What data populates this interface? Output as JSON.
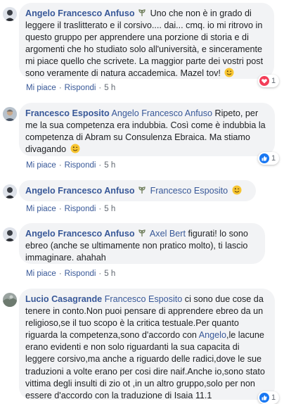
{
  "colors": {
    "link": "#385898",
    "bubble": "#f2f3f5",
    "meta": "#606770",
    "love": "#f33e58",
    "like": "#1877f2"
  },
  "comments": [
    {
      "author": "Angelo Francesco Anfuso",
      "badge_icon": "group-expert-badge-icon",
      "text": "Uno che non è in grado di leggere il traslitterato e il corsivo.... dai... cmq. io mi ritrovo in questo gruppo per apprendere una porzione di storia e di argomenti che ho studiato solo all'università, e sinceramente mi piace quello che scrivete. La maggior parte dei vostri post sono veramente di natura accademica. Mazel tov!",
      "emoji": "winking-face-emoji",
      "like": "Mi piace",
      "reply": "Rispondi",
      "time": "5 h",
      "reaction": {
        "icon": "love-reaction-icon",
        "count": "1"
      }
    },
    {
      "author": "Francesco Esposito",
      "mention": "Angelo Francesco Anfuso",
      "text": "Ripeto, per me la sua competenza era indubbia. Così come è indubbia la competenza di Abram su Consulenza Ebraica. Ma stiamo divagando",
      "emoji": "winking-face-emoji",
      "like": "Mi piace",
      "reply": "Rispondi",
      "time": "5 h",
      "reaction": {
        "icon": "like-reaction-icon",
        "count": "1"
      }
    },
    {
      "author": "Angelo Francesco Anfuso",
      "badge_icon": "group-expert-badge-icon",
      "mention": "Francesco Esposito",
      "emoji": "winking-face-emoji",
      "like": "Mi piace",
      "reply": "Rispondi",
      "time": "5 h"
    },
    {
      "author": "Angelo Francesco Anfuso",
      "badge_icon": "group-expert-badge-icon",
      "mention": "Axel Bert",
      "text": "figurati! lo sono ebreo (anche se ultimamente non pratico molto), ti lascio immaginare. ahahah",
      "like": "Mi piace",
      "reply": "Rispondi",
      "time": "5 h"
    },
    {
      "author": "Lucio Casagrande",
      "mention": "Francesco Esposito",
      "text_before": "ci sono due cose da tenere in conto.Non puoi pensare di apprendere ebreo da un religioso,se il tuo scopo è la critica testuale.Per quanto riguarda la competenza,sono d'accordo con",
      "mention2": "Angelo",
      "text_after": ",le lacune erano evidenti e non solo riguardanti la sua capacita di leggere corsivo,ma anche a riguardo delle radici,dove le sue traduzioni a volte erano per cosi dire naif.Anche io,sono stato vittima degli insulti di zio ot ,in un altro gruppo,solo per non essere d'accordo con la traduzione di Isaia 11.1",
      "reaction": {
        "icon": "like-reaction-icon",
        "count": "1"
      }
    }
  ]
}
